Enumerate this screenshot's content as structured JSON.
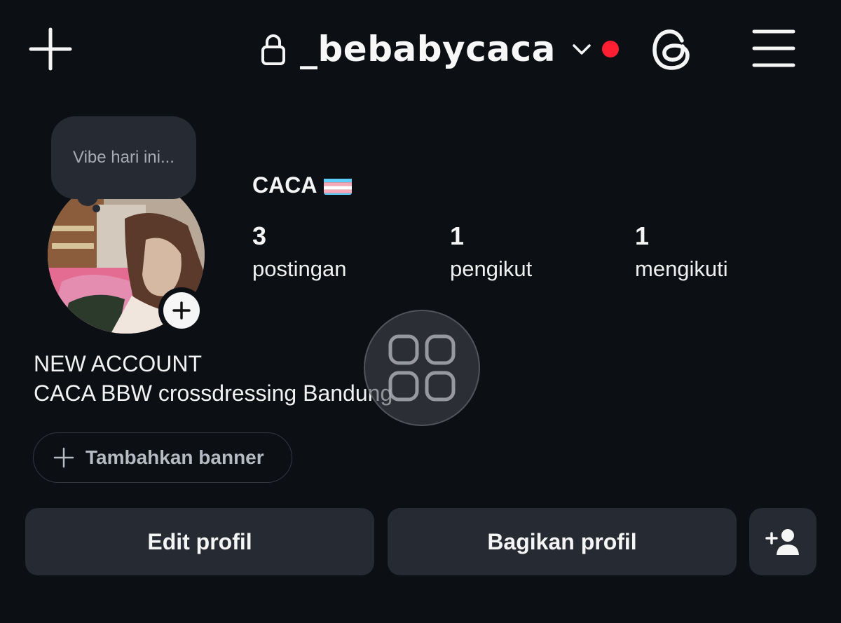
{
  "header": {
    "username": "_bebabycaca",
    "icons": [
      "plus-icon",
      "lock-icon",
      "chevron-down-icon",
      "threads-icon",
      "menu-icon"
    ],
    "notification_color": "#ff1f33"
  },
  "note": {
    "placeholder": "Vibe hari ini..."
  },
  "profile": {
    "display_name": "CACA",
    "flag_icon": "transgender-flag-icon",
    "stats": [
      {
        "value": "3",
        "label": "postingan"
      },
      {
        "value": "1",
        "label": "pengikut"
      },
      {
        "value": "1",
        "label": "mengikuti"
      }
    ],
    "bio": {
      "line1": "NEW ACCOUNT",
      "line2": "CACA BBW crossdressing Bandung"
    }
  },
  "banner": {
    "label": "Tambahkan banner"
  },
  "actions": {
    "edit": "Edit profil",
    "share": "Bagikan profil",
    "add_user_icon": "add-person-icon"
  },
  "overlay": {
    "icon": "app-grid-icon"
  },
  "colors": {
    "background": "#0c0f14",
    "surface": "#262a33",
    "accent_red": "#ff1f33"
  }
}
